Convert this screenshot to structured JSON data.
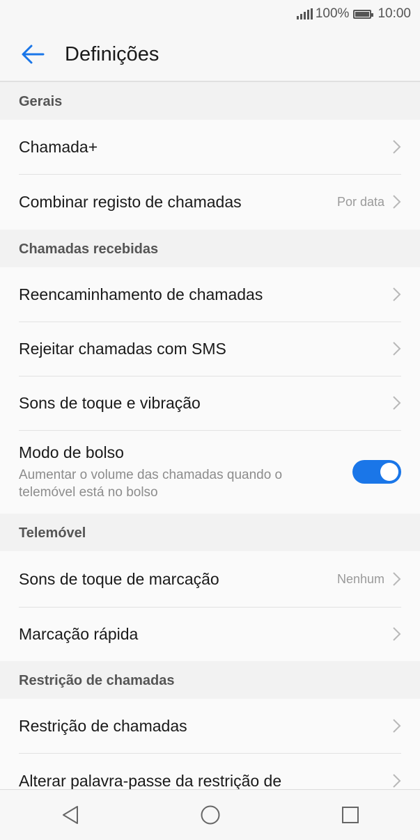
{
  "status": {
    "battery": "100%",
    "time": "10:00"
  },
  "header": {
    "title": "Definições"
  },
  "sections": {
    "gerais": {
      "title": "Gerais",
      "items": [
        {
          "label": "Chamada+"
        },
        {
          "label": "Combinar registo de chamadas",
          "value": "Por data"
        }
      ]
    },
    "recebidas": {
      "title": "Chamadas recebidas",
      "items": [
        {
          "label": "Reencaminhamento de chamadas"
        },
        {
          "label": "Rejeitar chamadas com SMS"
        },
        {
          "label": "Sons de toque e vibração"
        },
        {
          "label": "Modo de bolso",
          "description": "Aumentar o volume das chamadas quando o telemóvel está no bolso",
          "enabled": true
        }
      ]
    },
    "telemovel": {
      "title": "Telemóvel",
      "items": [
        {
          "label": "Sons de toque de marcação",
          "value": "Nenhum"
        },
        {
          "label": "Marcação rápida"
        }
      ]
    },
    "restricao": {
      "title": "Restrição de chamadas",
      "items": [
        {
          "label": "Restrição de chamadas"
        },
        {
          "label": "Alterar palavra-passe da restrição de"
        }
      ]
    }
  },
  "colors": {
    "accent": "#1a76e8"
  },
  "icons": {
    "back": "arrow-left-icon",
    "chevron": "chevron-right-icon",
    "nav": [
      "back-triangle-icon",
      "home-circle-icon",
      "recents-square-icon"
    ]
  }
}
